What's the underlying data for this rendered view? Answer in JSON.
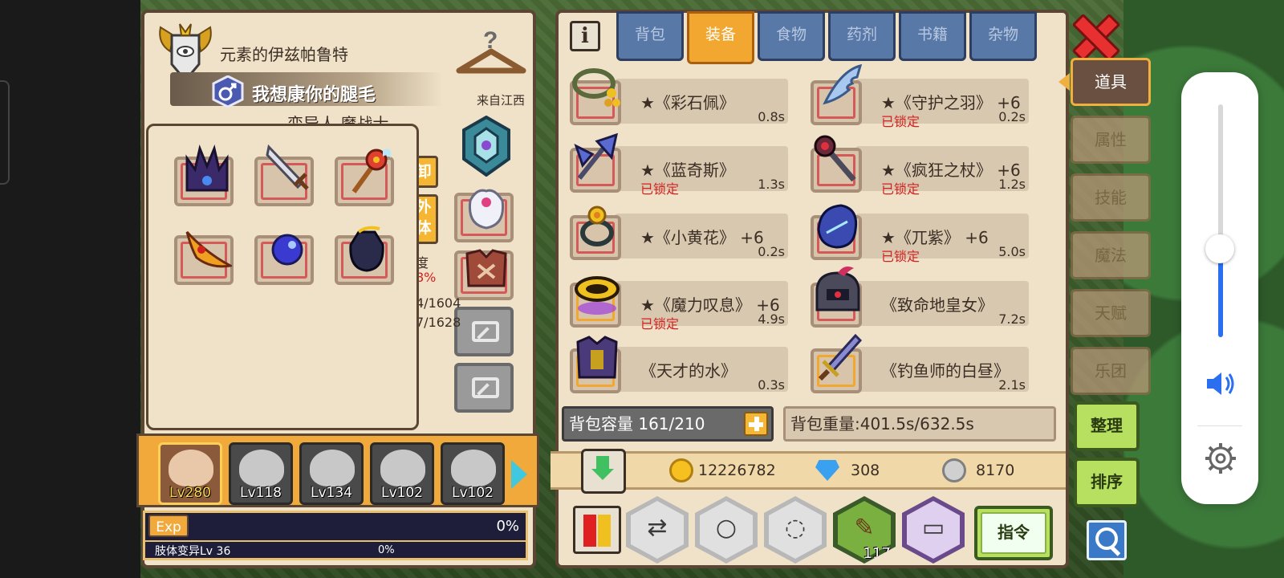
{
  "character": {
    "title": "元素的伊兹帕鲁特",
    "name": "我想康你的腿毛",
    "from": "来自江西",
    "subtitle_partial": "変异人 魔战士",
    "side_labels": [
      "卸",
      "外",
      "体",
      "度",
      "8%",
      "/1604",
      "/1628"
    ],
    "side_btn_remove": "卸",
    "side_btn_appearance": "外\n体",
    "durability_label": "度",
    "durability_value": "8%",
    "stat1": "4/1604",
    "stat2": "7/1628"
  },
  "equipped_slots": [
    {
      "name": "dark-crown-icon"
    },
    {
      "name": "blade-icon"
    },
    {
      "name": "winged-mace-icon"
    },
    {
      "name": "flame-wing-icon"
    },
    {
      "name": "blue-orb-icon"
    },
    {
      "name": "dark-gauntlet-icon"
    }
  ],
  "team": {
    "members": [
      {
        "level": "Lv280",
        "active": true
      },
      {
        "level": "Lv118",
        "active": false
      },
      {
        "level": "Lv134",
        "active": false
      },
      {
        "level": "Lv102",
        "active": false
      },
      {
        "level": "Lv102",
        "active": false
      }
    ]
  },
  "exp": {
    "tag": "Exp",
    "percent": "0%",
    "sub_label": "肢体变异Lv 36",
    "sub_percent": "0%",
    "progress": 0
  },
  "inventory": {
    "info_label": "i",
    "tabs": [
      {
        "label": "背包",
        "active": false
      },
      {
        "label": "装备",
        "active": true
      },
      {
        "label": "食物",
        "active": false
      },
      {
        "label": "药剂",
        "active": false
      },
      {
        "label": "书籍",
        "active": false
      },
      {
        "label": "杂物",
        "active": false
      }
    ],
    "items": [
      {
        "name": "★《彩石佩》",
        "locked": "",
        "time": "0.8s",
        "icon": "gem-necklace-icon",
        "frame": "red"
      },
      {
        "name": "★《守护之羽》 +6",
        "locked": "已锁定",
        "time": "0.2s",
        "icon": "guardian-feather-icon",
        "frame": "red"
      },
      {
        "name": "★《蓝奇斯》",
        "locked": "已锁定",
        "time": "1.3s",
        "icon": "blue-axe-icon",
        "frame": "red"
      },
      {
        "name": "★《疯狂之杖》 +6",
        "locked": "已锁定",
        "time": "1.2s",
        "icon": "mad-staff-icon",
        "frame": "red"
      },
      {
        "name": "★《小黄花》 +6",
        "locked": "",
        "time": "0.2s",
        "icon": "yellow-flower-ring-icon",
        "frame": "red"
      },
      {
        "name": "★《兀紫》 +6",
        "locked": "已锁定",
        "time": "5.0s",
        "icon": "purple-gauntlet-icon",
        "frame": "red"
      },
      {
        "name": "★《魔力叹息》 +6",
        "locked": "已锁定",
        "time": "4.9s",
        "icon": "magic-ring-icon",
        "frame": "gold"
      },
      {
        "name": "《致命地皇女》",
        "locked": "",
        "time": "7.2s",
        "icon": "dark-helm-icon",
        "frame": "red"
      },
      {
        "name": "《天才的水》",
        "locked": "",
        "time": "0.3s",
        "icon": "armor-icon",
        "frame": "gold"
      },
      {
        "name": "《钓鱼师的白昼》",
        "locked": "",
        "time": "2.1s",
        "icon": "sword-icon",
        "frame": "gold"
      }
    ],
    "capacity": "背包容量 161/210",
    "weight": "背包重量:401.5s/632.5s"
  },
  "currency": {
    "gold": "12226782",
    "gems": "308",
    "silver": "8170"
  },
  "actions": {
    "scroll_count": "117",
    "command": "指令"
  },
  "side_nav": {
    "tabs": [
      {
        "label": "道具",
        "active": true
      },
      {
        "label": "属性",
        "active": false
      },
      {
        "label": "技能",
        "active": false
      },
      {
        "label": "魔法",
        "active": false
      },
      {
        "label": "天赋",
        "active": false
      },
      {
        "label": "乐团",
        "active": false
      }
    ],
    "organize": "整理",
    "sort": "排序"
  },
  "volume": {
    "level": 0.38
  },
  "colors": {
    "panel_bg": "#efe2c8",
    "panel_border": "#5b4533",
    "tab_active": "#f2a830",
    "tab_inactive": "#5878a8",
    "locked_red": "#d52020",
    "accent_green": "#b8e060",
    "volume_blue": "#2a6ff0"
  }
}
